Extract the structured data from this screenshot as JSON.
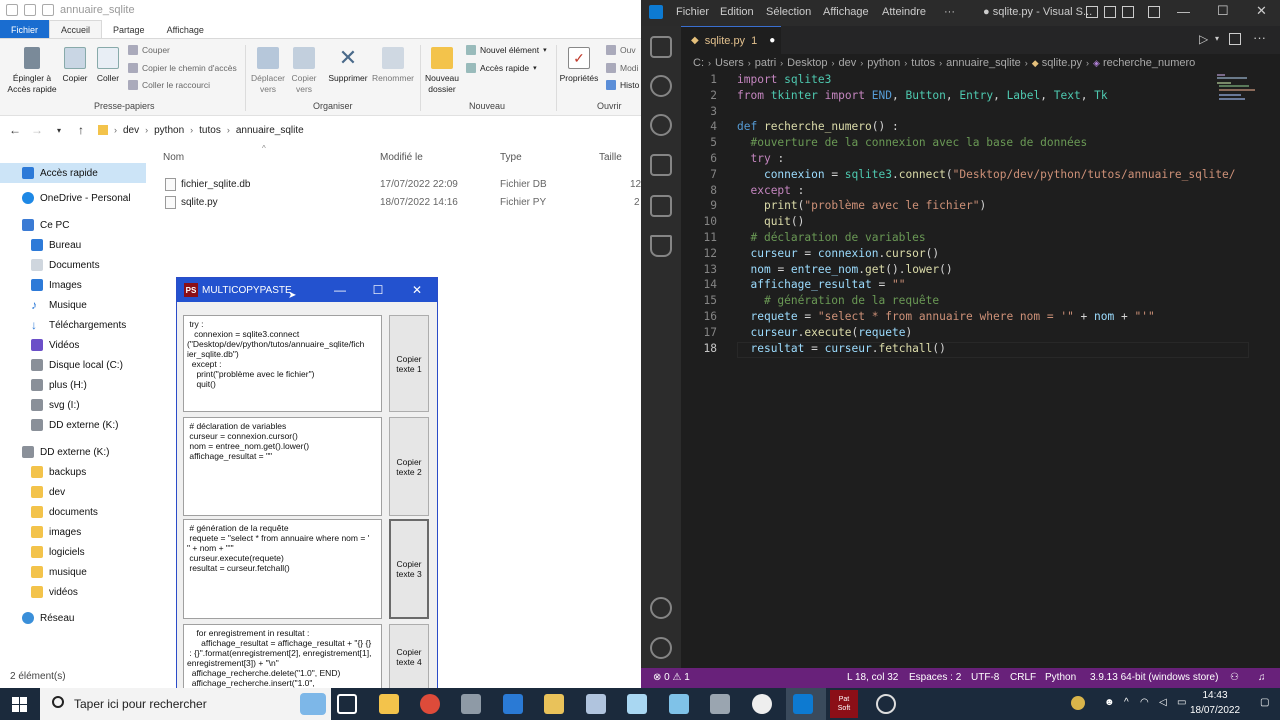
{
  "explorer": {
    "title": "annuaire_sqlite",
    "tabs": [
      "Fichier",
      "Accueil",
      "Partage",
      "Affichage"
    ],
    "ribbon": {
      "pin": "Épingler à\nAccès rapide",
      "copy": "Copier",
      "paste": "Coller",
      "cut": "Couper",
      "copy_path": "Copier le chemin d'accès",
      "paste_shortcut": "Coller le raccourci",
      "move_to": "Déplacer\nvers",
      "copy_to": "Copier\nvers",
      "delete": "Supprimer",
      "rename": "Renommer",
      "new_folder": "Nouveau\ndossier",
      "new_item": "Nouvel élément",
      "easy_access": "Accès rapide",
      "properties": "Propriétés",
      "open": "Ouv",
      "modify": "Modi",
      "history": "Histo",
      "groups": {
        "clipboard": "Presse-papiers",
        "organize": "Organiser",
        "new": "Nouveau",
        "open": "Ouvrir"
      }
    },
    "breadcrumb": [
      "dev",
      "python",
      "tutos",
      "annuaire_sqlite"
    ],
    "nav": [
      {
        "label": "Accès rapide",
        "icon": "star-icon"
      },
      {
        "label": "OneDrive - Personal",
        "icon": "cloud-icon"
      },
      {
        "label": "Ce PC",
        "icon": "pc-icon"
      },
      {
        "label": "Bureau",
        "icon": "folder-icon"
      },
      {
        "label": "Documents",
        "icon": "folder-icon"
      },
      {
        "label": "Images",
        "icon": "folder-icon"
      },
      {
        "label": "Musique",
        "icon": "music-icon"
      },
      {
        "label": "Téléchargements",
        "icon": "download-icon"
      },
      {
        "label": "Vidéos",
        "icon": "video-icon"
      },
      {
        "label": "Disque local (C:)",
        "icon": "drive-icon"
      },
      {
        "label": "plus (H:)",
        "icon": "drive-icon"
      },
      {
        "label": "svg (I:)",
        "icon": "drive-icon"
      },
      {
        "label": "DD externe (K:)",
        "icon": "drive-icon"
      },
      {
        "label": "DD externe (K:)",
        "icon": "drive-icon"
      },
      {
        "label": "backups",
        "icon": "folder-icon"
      },
      {
        "label": "dev",
        "icon": "folder-icon"
      },
      {
        "label": "documents",
        "icon": "folder-icon"
      },
      {
        "label": "images",
        "icon": "folder-icon"
      },
      {
        "label": "logiciels",
        "icon": "folder-icon"
      },
      {
        "label": "musique",
        "icon": "folder-icon"
      },
      {
        "label": "vidéos",
        "icon": "folder-icon"
      },
      {
        "label": "Réseau",
        "icon": "network-icon"
      }
    ],
    "columns": [
      "Nom",
      "Modifié le",
      "Type",
      "Taille"
    ],
    "files": [
      {
        "name": "fichier_sqlite.db",
        "modified": "17/07/2022 22:09",
        "type": "Fichier DB",
        "size": "12"
      },
      {
        "name": "sqlite.py",
        "modified": "18/07/2022 14:16",
        "type": "Fichier PY",
        "size": "2"
      }
    ],
    "status": "2 élément(s)"
  },
  "multicopypaste": {
    "logo": "PS",
    "title": "MULTICOPYPASTE",
    "boxes": [
      {
        "text": " try :\n   connexion = sqlite3.connect\n(\"Desktop/dev/python/tutos/annuaire_sqlite/fich\nier_sqlite.db\")\n  except :\n    print(\"problème avec le fichier\")\n    quit()",
        "button": "Copier\ntexte 1"
      },
      {
        "text": " # déclaration de variables\n curseur = connexion.cursor()\n nom = entree_nom.get().lower()\n affichage_resultat = \"\"",
        "button": "Copier\ntexte 2"
      },
      {
        "text": " # génération de la requête\n requete = \"select * from annuaire where nom = '\n\" + nom + \"'\"\n curseur.execute(requete)\n resultat = curseur.fetchall()",
        "button": "Copier\ntexte 3"
      },
      {
        "text": "    for enregistrement in resultat :\n      affichage_resultat = affichage_resultat + \"{} {}\n : {}\".format(enregistrement[2], enregistrement[1],\nenregistrement[3]) + \"\\n\"\n  affichage_recherche.delete(\"1.0\", END)\n  affichage_recherche.insert(\"1.0\",",
        "button": "Copier\ntexte 4"
      }
    ]
  },
  "vscode": {
    "menu": [
      "Fichier",
      "Edition",
      "Sélection",
      "Affichage",
      "Atteindre",
      "···"
    ],
    "window_title": "● sqlite.py - Visual S...",
    "tab": {
      "label": "sqlite.py",
      "problems": "1"
    },
    "breadcrumb": [
      "C:",
      "Users",
      "patri",
      "Desktop",
      "dev",
      "python",
      "tutos",
      "annuaire_sqlite",
      "sqlite.py",
      "recherche_numero"
    ],
    "code_lines": [
      "import sqlite3",
      "from tkinter import END, Button, Entry, Label, Text, Tk",
      "",
      "def recherche_numero() :",
      "  #ouverture de la connexion avec la base de données",
      "  try :",
      "    connexion = sqlite3.connect(\"Desktop/dev/python/tutos/annuaire_sqlite/",
      "  except :",
      "    print(\"problème avec le fichier\")",
      "    quit()",
      "  # déclaration de variables",
      "  curseur = connexion.cursor()",
      "  nom = entree_nom.get().lower()",
      "  affichage_resultat = \"\"",
      "    # génération de la requête",
      "  requete = \"select * from annuaire where nom = '\" + nom + \"'\"",
      "  curseur.execute(requete)",
      "  resultat = curseur.fetchall()"
    ],
    "status": {
      "problems": "⊗ 0 ⚠ 1",
      "position": "L 18, col 32",
      "spaces": "Espaces : 2",
      "encoding": "UTF-8",
      "eol": "CRLF",
      "language": "Python",
      "interpreter": "3.9.13 64-bit (windows store)"
    }
  },
  "taskbar": {
    "search_placeholder": "Taper ici pour rechercher",
    "time": "14:43",
    "date": "18/07/2022",
    "pat_soft": "Pat\nSoft"
  },
  "colors": {
    "vscode_status": "#68217a",
    "taskbar": "#1b2a3c",
    "mcp_title": "#2352cf",
    "explorer_file_tab": "#1a6dd0"
  }
}
